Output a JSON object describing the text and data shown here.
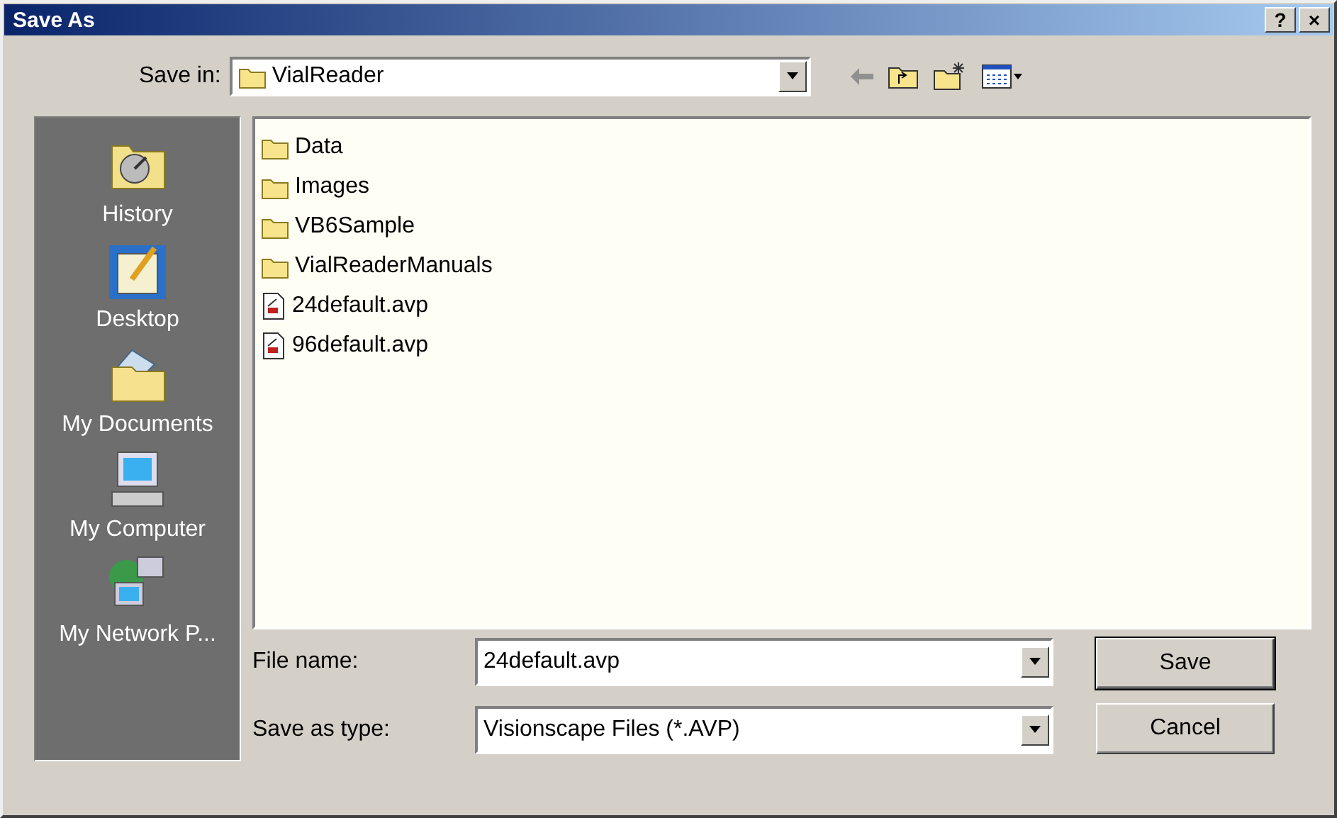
{
  "window": {
    "title": "Save As",
    "controls": [
      "?",
      "×"
    ]
  },
  "save_in": {
    "label": "Save in:",
    "value": "VialReader"
  },
  "places": [
    {
      "label": "History",
      "kind": "history"
    },
    {
      "label": "Desktop",
      "kind": "desktop"
    },
    {
      "label": "My Documents",
      "kind": "documents"
    },
    {
      "label": "My Computer",
      "kind": "computer"
    },
    {
      "label": "My Network P...",
      "kind": "network"
    }
  ],
  "files": [
    {
      "name": "Data",
      "kind": "folder"
    },
    {
      "name": "Images",
      "kind": "folder"
    },
    {
      "name": "VB6Sample",
      "kind": "folder"
    },
    {
      "name": "VialReaderManuals",
      "kind": "folder"
    },
    {
      "name": "24default.avp",
      "kind": "file"
    },
    {
      "name": "96default.avp",
      "kind": "file"
    }
  ],
  "file_name": {
    "label": "File name:",
    "value": "24default.avp"
  },
  "save_as_type": {
    "label": "Save as type:",
    "value": "Visionscape Files (*.AVP)"
  },
  "buttons": [
    {
      "label": "Save",
      "default": true
    },
    {
      "label": "Cancel",
      "default": false
    }
  ]
}
